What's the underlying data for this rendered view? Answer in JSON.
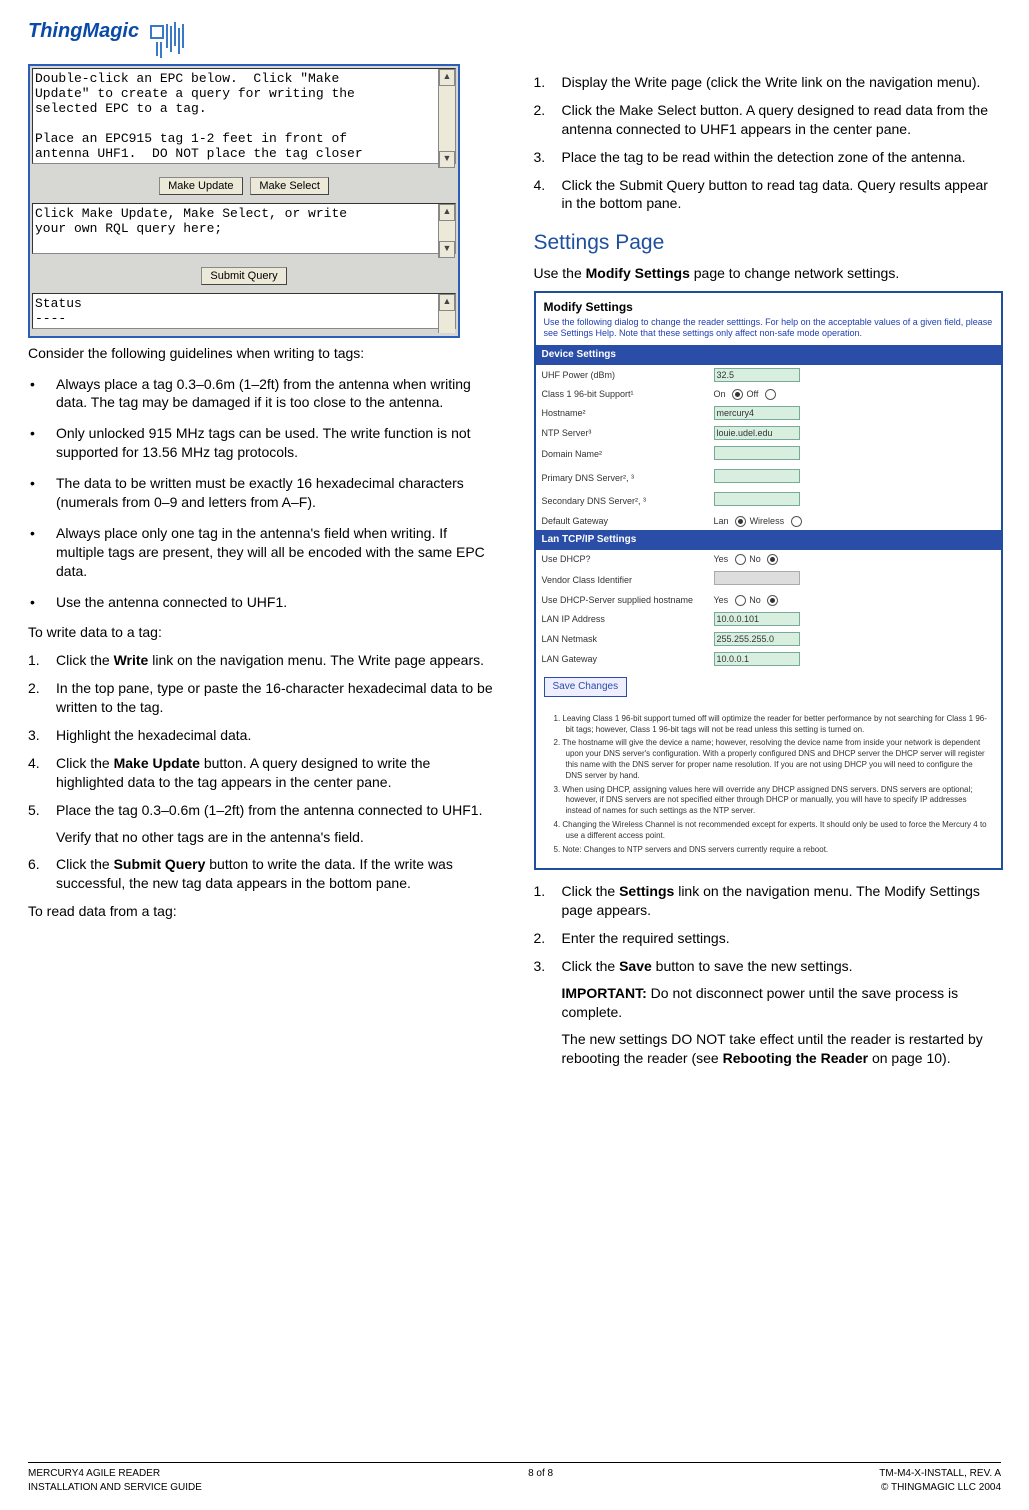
{
  "logo": {
    "brand": "ThingMagic"
  },
  "screenshot_panel": {
    "top_text": "Double-click an EPC below.  Click \"Make\nUpdate\" to create a query for writing the\nselected EPC to a tag.\n\nPlace an EPC915 tag 1-2 feet in front of\nantenna UHF1.  DO NOT place the tag closer",
    "btn_make_update": "Make Update",
    "btn_make_select": "Make Select",
    "mid_text": "Click Make Update, Make Select, or write\nyour own RQL query here;",
    "btn_submit": "Submit Query",
    "status_text": "Status\n----"
  },
  "left": {
    "intro": "Consider the following guidelines when writing to tags:",
    "bullets": [
      "Always place a tag 0.3–0.6m (1–2ft) from the antenna when writing data. The tag may be damaged if it is too close to the antenna.",
      "Only unlocked 915 MHz tags can be used. The write function is not supported for 13.56 MHz tag protocols.",
      "The data to be written must be exactly 16 hexadecimal characters (numerals from 0–9 and letters from A–F).",
      "Always place only one tag in the antenna's field when writing. If multiple tags are present, they will all be encoded with the same EPC data.",
      "Use the antenna connected to UHF1."
    ],
    "write_intro": "To write data to a tag:",
    "write_steps": {
      "s1a": "Click the ",
      "s1b": "Write",
      "s1c": " link on the navigation menu. The Write page appears.",
      "s2": "In the top pane, type or paste the 16-character hexadecimal data to be written to the tag.",
      "s3": "Highlight the hexadecimal data.",
      "s4a": "Click the ",
      "s4b": "Make Update",
      "s4c": " button. A query designed to write the highlighted data to the tag appears in the center pane.",
      "s5": "Place the tag 0.3–0.6m (1–2ft) from the antenna connected to UHF1.",
      "s5sub": "Verify that no other tags are in the antenna's field.",
      "s6a": "Click the ",
      "s6b": "Submit Query",
      "s6c": " button to write the data. If the write was successful, the new tag data appears in the bottom pane."
    },
    "read_intro": "To read data from a tag:"
  },
  "right": {
    "read_steps": {
      "s1": "Display the Write page (click the Write link on the navigation menu).",
      "s2": "Click the Make Select button. A query designed to read data from the antenna connected to UHF1 appears in the center pane.",
      "s3": "Place the tag to be read within the detection zone of the antenna.",
      "s4": "Click the Submit Query button to read tag data. Query results appear in the bottom pane."
    },
    "heading": "Settings Page",
    "desc_a": "Use the ",
    "desc_b": "Modify Settings",
    "desc_c": " page to change network settings.",
    "settings_shot": {
      "title": "Modify Settings",
      "hint": "Use the following dialog to change the reader setttings. For help on the acceptable values of a given field, please see Settings Help. Note that these settings only affect non-safe mode operation.",
      "bar1": "Device Settings",
      "row_uhf": "UHF Power (dBm)",
      "val_uhf": "32.5",
      "row_c1": "Class 1 96-bit Support¹",
      "c1_on": "On",
      "c1_off": "Off",
      "row_host": "Hostname²",
      "val_host": "mercury4",
      "row_ntp": "NTP Server³",
      "val_ntp": "louie.udel.edu",
      "row_dom": "Domain Name²",
      "row_pdns": "Primary DNS Server², ³",
      "row_sdns": "Secondary DNS Server², ³",
      "row_gw": "Default Gateway",
      "gw_lan": "Lan",
      "gw_wl": "Wireless",
      "bar2": "Lan TCP/IP Settings",
      "row_dhcp": "Use DHCP?",
      "yes": "Yes",
      "no": "No",
      "row_vci": "Vendor Class Identifier",
      "row_dhcphost": "Use DHCP-Server supplied hostname",
      "row_lanip": "LAN IP Address",
      "val_lanip": "10.0.0.101",
      "row_lanmask": "LAN Netmask",
      "val_lanmask": "255.255.255.0",
      "row_langw": "LAN Gateway",
      "val_langw": "10.0.0.1",
      "save": "Save Changes",
      "n1": "1.   Leaving Class 1 96-bit support turned off will optimize the reader for better performance by not searching for Class 1 96-bit tags; however, Class 1 96-bit tags will not be read unless this setting is turned on.",
      "n2": "2.   The hostname will give the device a name; however, resolving the device name from inside your network is dependent upon your DNS server's configuration. With a properly configured DNS and DHCP server the DHCP server will register this name with the DNS server for proper name resolution. If you are not using DHCP you will need to configure the DNS server by hand.",
      "n3": "3.   When using DHCP, assigning values here will override any DHCP assigned DNS servers. DNS servers are optional; however, if DNS servers are not specified either through DHCP or manually, you will have to specify IP addresses instead of names for such settings as the NTP server.",
      "n4": "4.   Changing the Wireless Channel is not recommended except for experts. It should only be used to force the Mercury 4 to use a different access point.",
      "n5": "5.   Note: Changes to NTP servers and DNS servers currently require a reboot."
    },
    "set_steps": {
      "s1a": "Click the ",
      "s1b": "Settings",
      "s1c": " link on the navigation menu. The Modify Settings page appears.",
      "s2": "Enter the required settings.",
      "s3a": "Click the ",
      "s3b": "Save",
      "s3c": " button to save the new settings.",
      "imp_a": "IMPORTANT:",
      "imp_b": " Do not disconnect power until the save process is complete.",
      "note_a": "The new settings DO NOT take effect until the reader is restarted by rebooting the reader (see ",
      "note_b": "Rebooting the Reader",
      "note_c": " on page 10)."
    }
  },
  "footer": {
    "l1": "MERCURY4 AGILE READER",
    "l2": "INSTALLATION AND SERVICE GUIDE",
    "c": "8 of 8",
    "r1": "TM-M4-X-INSTALL, REV. A",
    "r2": "© THINGMAGIC LLC 2004"
  }
}
